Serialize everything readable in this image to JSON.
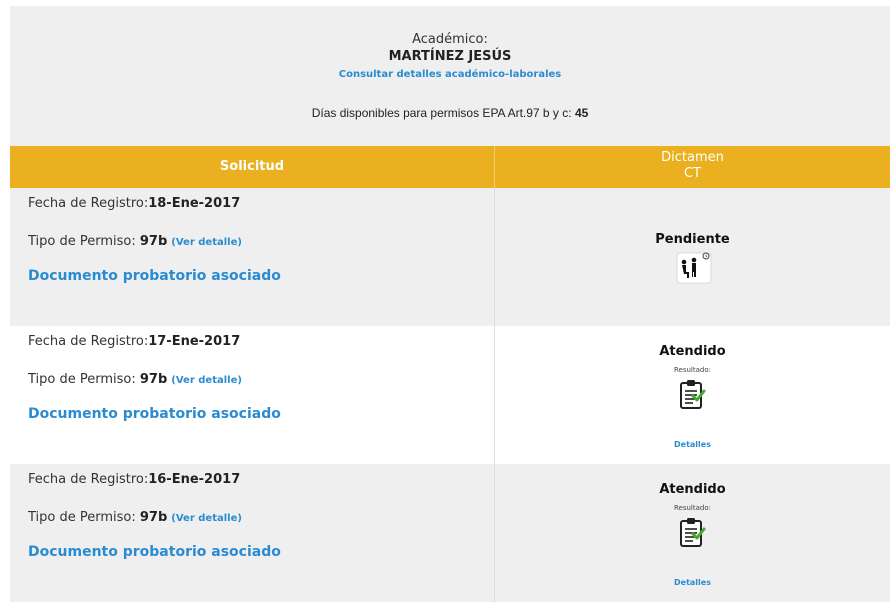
{
  "header": {
    "label": "Académico:",
    "name": "MARTÍNEZ JESÚS",
    "link": "Consultar detalles académico-laborales",
    "days_text": "Días disponibles para permisos EPA Art.97 b y c: ",
    "days_value": "45"
  },
  "table": {
    "col1": "Solicitud",
    "col2_line1": "Dictamen",
    "col2_line2": "CT"
  },
  "rows": [
    {
      "fecha_label": "Fecha de Registro:",
      "fecha": "18-Ene-2017",
      "tipo_label": "Tipo de Permiso: ",
      "tipo": "97b",
      "ver": "(Ver detalle)",
      "doc": "Documento probatorio asociado",
      "status": "Pendiente",
      "icon": "waiting-room-icon"
    },
    {
      "fecha_label": "Fecha de Registro:",
      "fecha": "17-Ene-2017",
      "tipo_label": "Tipo de Permiso: ",
      "tipo": "97b",
      "ver": "(Ver detalle)",
      "doc": "Documento probatorio asociado",
      "status": "Atendido",
      "resultado": "Resultado:",
      "icon": "clipboard-check-icon",
      "detalles": "Detalles"
    },
    {
      "fecha_label": "Fecha de Registro:",
      "fecha": "16-Ene-2017",
      "tipo_label": "Tipo de Permiso: ",
      "tipo": "97b",
      "ver": "(Ver detalle)",
      "doc": "Documento probatorio asociado",
      "status": "Atendido",
      "resultado": "Resultado:",
      "icon": "clipboard-check-icon",
      "detalles": "Detalles"
    }
  ],
  "colors": {
    "header_bg": "#eab01f",
    "link": "#2a8cd0",
    "row_gray": "#efefef"
  }
}
